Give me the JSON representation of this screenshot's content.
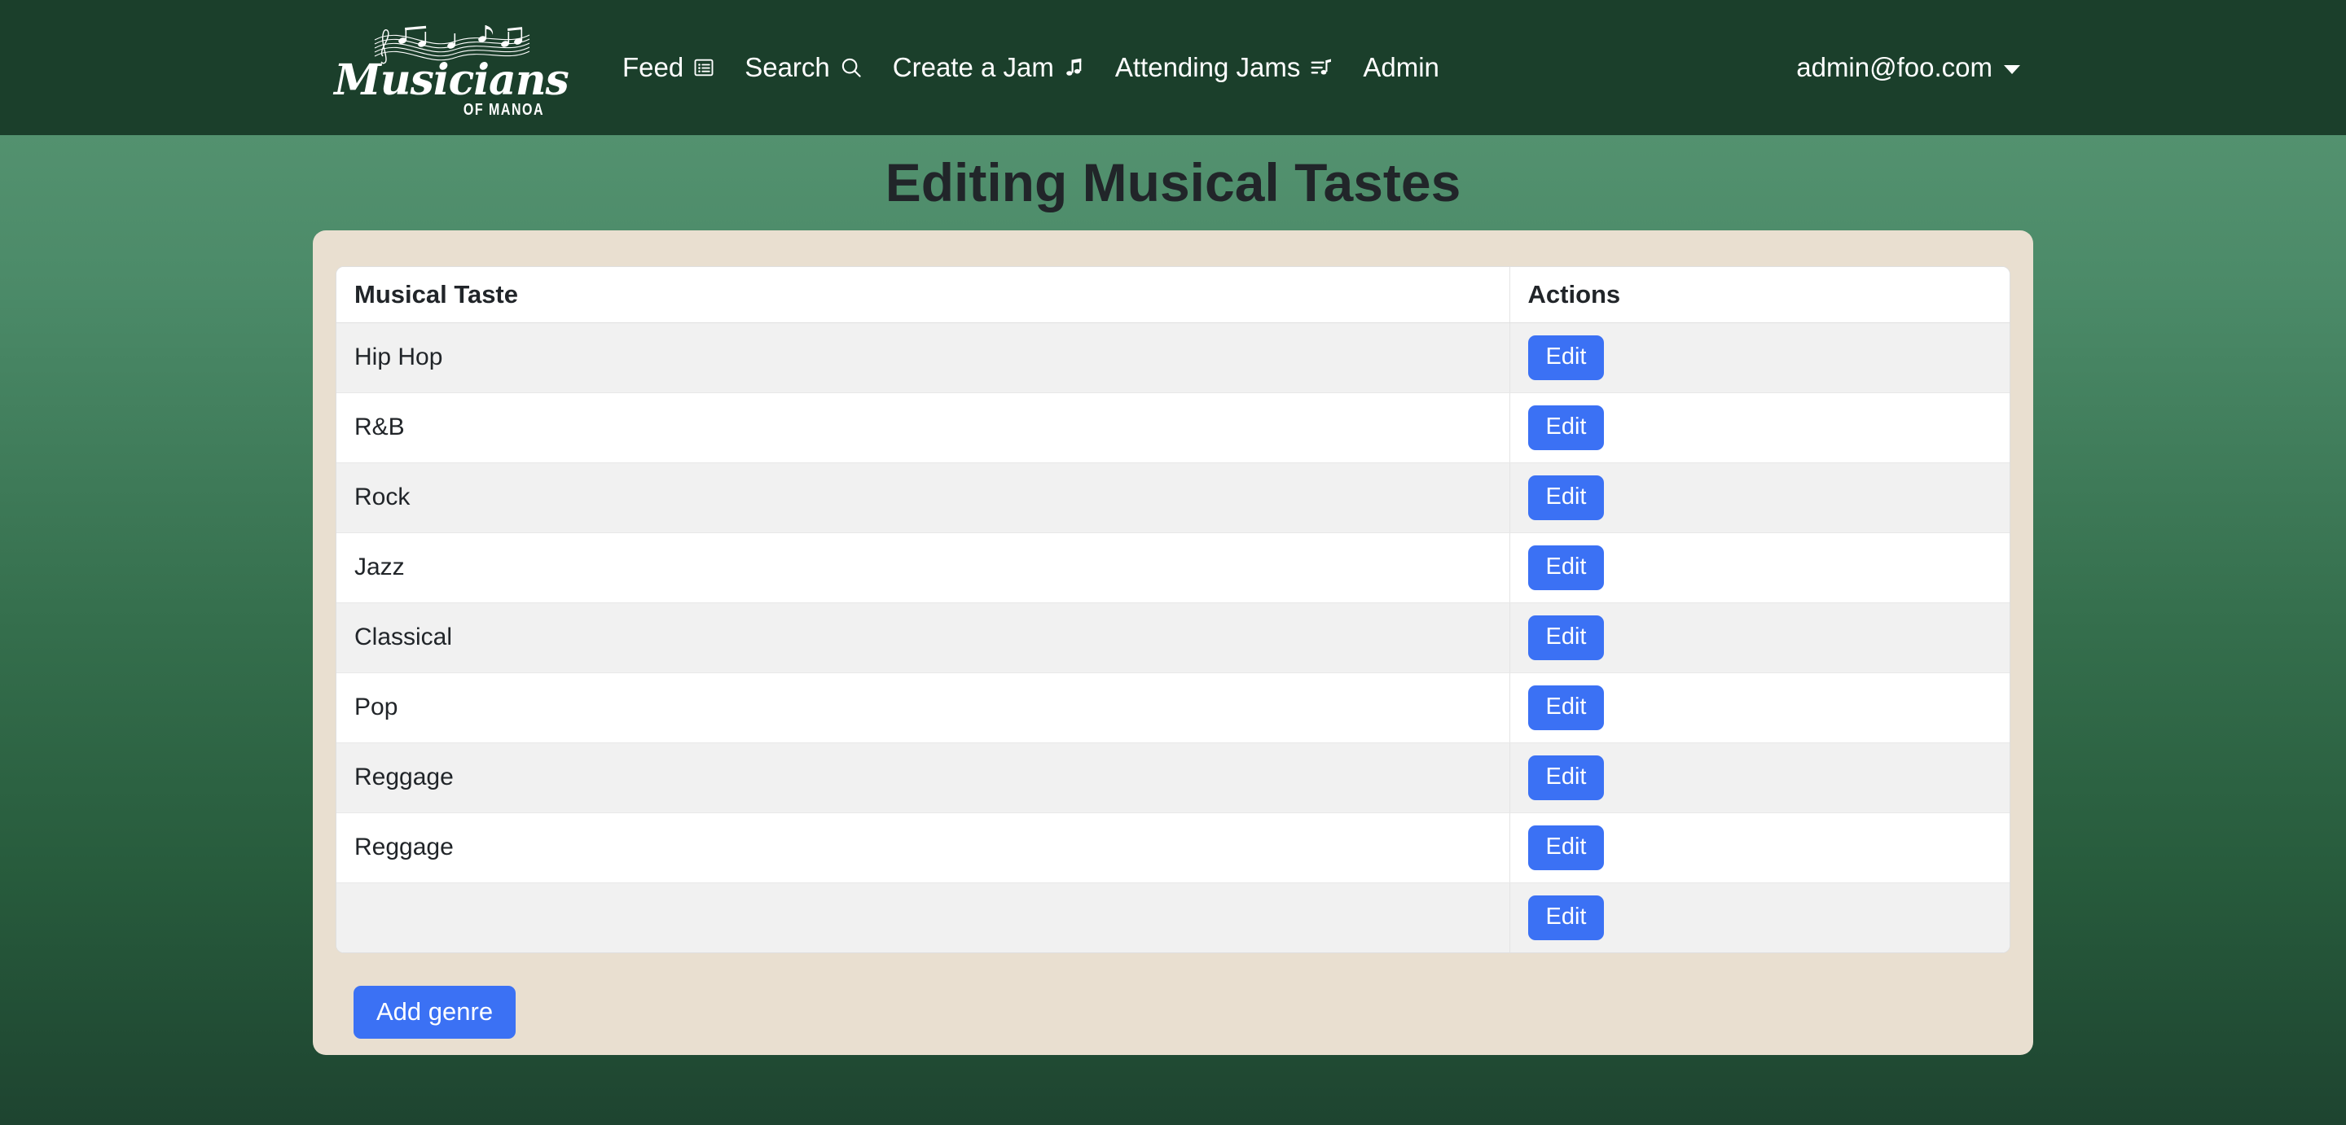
{
  "navbar": {
    "brand": {
      "word": "Musicians",
      "subtitle": "OF MANOA",
      "icon": "music-staff-icon"
    },
    "links": [
      {
        "label": "Feed",
        "icon": "feed-list-icon"
      },
      {
        "label": "Search",
        "icon": "search-icon"
      },
      {
        "label": "Create a Jam",
        "icon": "music-note-icon"
      },
      {
        "label": "Attending Jams",
        "icon": "playlist-note-icon"
      },
      {
        "label": "Admin",
        "icon": ""
      }
    ],
    "user": {
      "email": "admin@foo.com",
      "caret_icon": "chevron-down-icon"
    },
    "background_color": "#1b3f2b"
  },
  "page": {
    "title": "Editing Musical Tastes",
    "gradient_top": "#5a9875",
    "gradient_bottom": "#1e4430",
    "card_color": "#e9dfd0"
  },
  "table": {
    "columns": [
      "Musical Taste",
      "Actions"
    ],
    "rows": [
      {
        "taste": "Hip Hop",
        "action": "Edit"
      },
      {
        "taste": "R&B",
        "action": "Edit"
      },
      {
        "taste": "Rock",
        "action": "Edit"
      },
      {
        "taste": "Jazz",
        "action": "Edit"
      },
      {
        "taste": "Classical",
        "action": "Edit"
      },
      {
        "taste": "Pop",
        "action": "Edit"
      },
      {
        "taste": "Reggage",
        "action": "Edit"
      },
      {
        "taste": "Reggage",
        "action": "Edit"
      },
      {
        "taste": "",
        "action": "Edit"
      }
    ]
  },
  "actions": {
    "add_genre_label": "Add genre",
    "primary_color": "#3b71f4"
  }
}
